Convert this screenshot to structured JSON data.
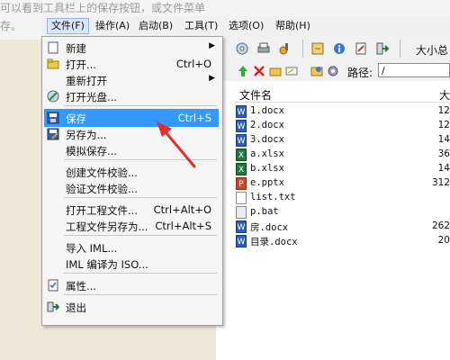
{
  "background": {
    "line1": "可以看到工具栏上的保存按钮，或文件菜单",
    "line2": "存。"
  },
  "menubar": {
    "items": [
      {
        "label": "文件(F)"
      },
      {
        "label": "操作(A)"
      },
      {
        "label": "启动(B)"
      },
      {
        "label": "工具(T)"
      },
      {
        "label": "选项(O)"
      },
      {
        "label": "帮助(H)"
      }
    ]
  },
  "toolbar": {
    "big_label": "大小总"
  },
  "toolbar2": {
    "path_label": "路径:",
    "path_value": "/"
  },
  "file_list": {
    "header_name": "文件名",
    "header_size": "大",
    "rows": [
      {
        "name": "1.docx",
        "size": "12",
        "type": "docx"
      },
      {
        "name": "2.docx",
        "size": "12",
        "type": "docx"
      },
      {
        "name": "3.docx",
        "size": "14",
        "type": "docx"
      },
      {
        "name": "a.xlsx",
        "size": "36",
        "type": "xlsx"
      },
      {
        "name": "b.xlsx",
        "size": "14",
        "type": "xlsx"
      },
      {
        "name": "e.pptx",
        "size": "312",
        "type": "pptx"
      },
      {
        "name": "list.txt",
        "size": "",
        "type": "txt"
      },
      {
        "name": "p.bat",
        "size": "",
        "type": "bat"
      },
      {
        "name": "房.docx",
        "size": "262",
        "type": "docx"
      },
      {
        "name": "目录.docx",
        "size": "20",
        "type": "docx"
      }
    ]
  },
  "file_menu": {
    "items": [
      {
        "label": "新建",
        "shortcut": "",
        "submenu": true,
        "icon": "new-file-icon"
      },
      {
        "label": "打开...",
        "shortcut": "Ctrl+O",
        "submenu": false,
        "icon": "open-folder-icon"
      },
      {
        "label": "重新打开",
        "shortcut": "",
        "submenu": true,
        "icon": ""
      },
      {
        "label": "打开光盘...",
        "shortcut": "",
        "submenu": false,
        "icon": "open-disc-icon"
      },
      {
        "label": "保存",
        "shortcut": "Ctrl+S",
        "submenu": false,
        "icon": "save-icon",
        "highlighted": true
      },
      {
        "label": "另存为...",
        "shortcut": "",
        "submenu": false,
        "icon": "save-as-icon"
      },
      {
        "label": "模拟保存...",
        "shortcut": "",
        "submenu": false,
        "icon": ""
      },
      {
        "label": "创建文件校验...",
        "shortcut": "",
        "submenu": false,
        "icon": ""
      },
      {
        "label": "验证文件校验...",
        "shortcut": "",
        "submenu": false,
        "icon": ""
      },
      {
        "label": "打开工程文件...",
        "shortcut": "Ctrl+Alt+O",
        "submenu": false,
        "icon": ""
      },
      {
        "label": "工程文件另存为...",
        "shortcut": "Ctrl+Alt+S",
        "submenu": false,
        "icon": ""
      },
      {
        "label": "导入 IML...",
        "shortcut": "",
        "submenu": false,
        "icon": ""
      },
      {
        "label": "IML 编译为 ISO...",
        "shortcut": "",
        "submenu": false,
        "icon": ""
      },
      {
        "label": "属性...",
        "shortcut": "",
        "submenu": false,
        "icon": "properties-icon"
      },
      {
        "label": "退出",
        "shortcut": "",
        "submenu": false,
        "icon": "exit-icon"
      }
    ]
  },
  "colors": {
    "highlight": "#3399ff",
    "arrow": "#e0302a",
    "docx": "#2b5fb4",
    "xlsx": "#1f7a3a",
    "pptx": "#d0452b"
  }
}
